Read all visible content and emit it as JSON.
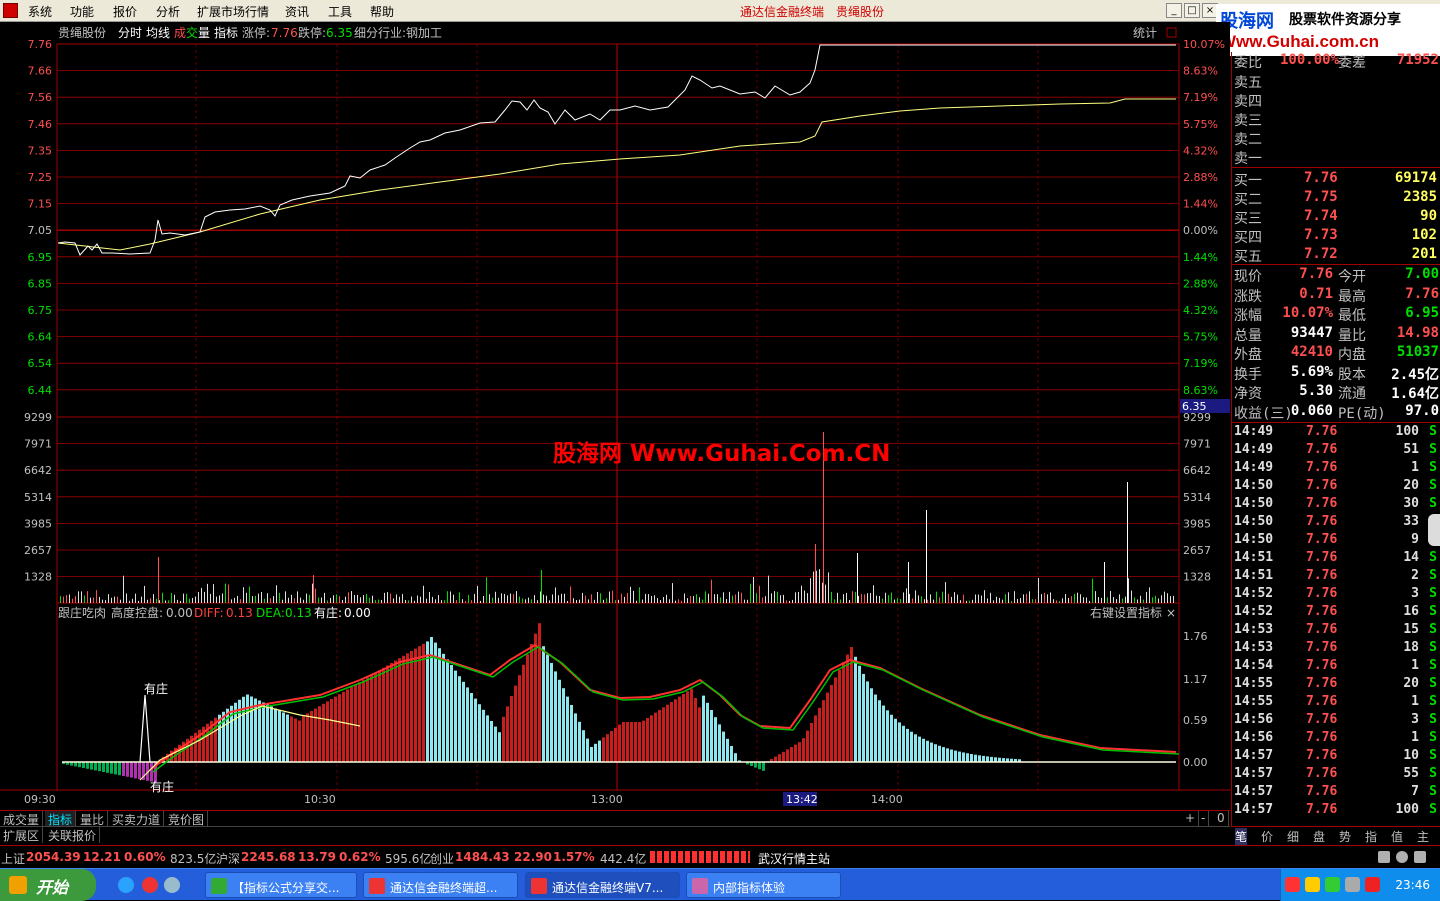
{
  "app": {
    "title": "通达信金融终端",
    "stock_title": "贵绳股份"
  },
  "menu": [
    "系统",
    "功能",
    "报价",
    "分析",
    "扩展市场行情",
    "资讯",
    "工具",
    "帮助"
  ],
  "brand": {
    "cn": "股海网",
    "sub": "股票软件资源分享",
    "url": "Www.Guhai.com.cn"
  },
  "chart_header": {
    "name": "贵绳股份",
    "tabs": [
      "分时",
      "均线"
    ],
    "vol_a": "成",
    "vol_b": "交",
    "vol_c": "量",
    "indicator": "指标",
    "limit_up_label": "涨停:",
    "limit_up": "7.76",
    "limit_down_label": "跌停:",
    "limit_down": "6.35",
    "industry": "细分行业:钢加工",
    "stats": "统计"
  },
  "price_axis": [
    "7.76",
    "7.66",
    "7.56",
    "7.46",
    "7.35",
    "7.25",
    "7.15",
    "7.05",
    "6.95",
    "6.85",
    "6.75",
    "6.64",
    "6.54",
    "6.44"
  ],
  "pct_axis": [
    "10.07%",
    "8.63%",
    "7.19%",
    "5.75%",
    "4.32%",
    "2.88%",
    "1.44%",
    "0.00%",
    "1.44%",
    "2.88%",
    "4.32%",
    "5.75%",
    "7.19%",
    "8.63%"
  ],
  "vol_axis": [
    "9299",
    "7971",
    "6642",
    "5314",
    "3985",
    "2657",
    "1328"
  ],
  "price_floor_tag": "6.35",
  "watermark": "股海网 Www.Guhai.Com.CN",
  "indicator": {
    "name": "跟庄吃肉",
    "k1": "高度控盘:",
    "v1": "0.00",
    "k2": "DIFF:",
    "v2": "0.13",
    "k3": "DEA:",
    "v3": "0.13",
    "k4": "有庄:",
    "v4": "0.00",
    "hint": "右键设置指标",
    "axis": [
      "1.76",
      "1.17",
      "0.59",
      "0.00"
    ],
    "marker1": "有庄",
    "marker2": "有庄"
  },
  "time_axis": [
    "09:30",
    "10:30",
    "13:00",
    "13:42",
    "14:00"
  ],
  "colors": {
    "up": "#ff5050",
    "down": "#00e000",
    "grid": "#a00000",
    "price": "#ffffff",
    "avg": "#ffff80",
    "bar_red": "#c81e1e",
    "bar_cyan": "#8ee6ee"
  },
  "order_book": {
    "ratio_label": "委比",
    "ratio": "100.00%",
    "diff_label": "委差",
    "diff": "71952",
    "sells": [
      "卖五",
      "卖四",
      "卖三",
      "卖二",
      "卖一"
    ],
    "buys": [
      {
        "label": "买一",
        "price": "7.76",
        "vol": "69174"
      },
      {
        "label": "买二",
        "price": "7.75",
        "vol": "2385"
      },
      {
        "label": "买三",
        "price": "7.74",
        "vol": "90"
      },
      {
        "label": "买四",
        "price": "7.73",
        "vol": "102"
      },
      {
        "label": "买五",
        "price": "7.72",
        "vol": "201"
      }
    ]
  },
  "quote": [
    {
      "l1": "现价",
      "v1": "7.76",
      "l2": "今开",
      "v2": "7.00",
      "c1": "up",
      "c2": "down"
    },
    {
      "l1": "涨跌",
      "v1": "0.71",
      "l2": "最高",
      "v2": "7.76",
      "c1": "up",
      "c2": "up"
    },
    {
      "l1": "涨幅",
      "v1": "10.07%",
      "l2": "最低",
      "v2": "6.95",
      "c1": "up",
      "c2": "down"
    },
    {
      "l1": "总量",
      "v1": "93447",
      "l2": "量比",
      "v2": "14.98",
      "c1": "white",
      "c2": "up"
    },
    {
      "l1": "外盘",
      "v1": "42410",
      "l2": "内盘",
      "v2": "51037",
      "c1": "up",
      "c2": "down"
    },
    {
      "l1": "换手",
      "v1": "5.69%",
      "l2": "股本",
      "v2": "2.45亿",
      "c1": "white",
      "c2": "white"
    },
    {
      "l1": "净资",
      "v1": "5.30",
      "l2": "流通",
      "v2": "1.64亿",
      "c1": "white",
      "c2": "white"
    },
    {
      "l1": "收益(三)",
      "v1": "0.060",
      "l2": "PE(动)",
      "v2": "97.0",
      "c1": "white",
      "c2": "white"
    }
  ],
  "ticks": [
    {
      "t": "14:49",
      "p": "7.76",
      "v": "100",
      "s": "S"
    },
    {
      "t": "14:49",
      "p": "7.76",
      "v": "51",
      "s": "S"
    },
    {
      "t": "14:49",
      "p": "7.76",
      "v": "1",
      "s": "S"
    },
    {
      "t": "14:50",
      "p": "7.76",
      "v": "20",
      "s": "S"
    },
    {
      "t": "14:50",
      "p": "7.76",
      "v": "30",
      "s": "S"
    },
    {
      "t": "14:50",
      "p": "7.76",
      "v": "33",
      "s": "S"
    },
    {
      "t": "14:50",
      "p": "7.76",
      "v": "9",
      "s": "S"
    },
    {
      "t": "14:51",
      "p": "7.76",
      "v": "14",
      "s": "S"
    },
    {
      "t": "14:51",
      "p": "7.76",
      "v": "2",
      "s": "S"
    },
    {
      "t": "14:52",
      "p": "7.76",
      "v": "3",
      "s": "S"
    },
    {
      "t": "14:52",
      "p": "7.76",
      "v": "16",
      "s": "S"
    },
    {
      "t": "14:53",
      "p": "7.76",
      "v": "15",
      "s": "S"
    },
    {
      "t": "14:53",
      "p": "7.76",
      "v": "18",
      "s": "S"
    },
    {
      "t": "14:54",
      "p": "7.76",
      "v": "1",
      "s": "S"
    },
    {
      "t": "14:55",
      "p": "7.76",
      "v": "20",
      "s": "S"
    },
    {
      "t": "14:55",
      "p": "7.76",
      "v": "1",
      "s": "S"
    },
    {
      "t": "14:56",
      "p": "7.76",
      "v": "3",
      "s": "S"
    },
    {
      "t": "14:56",
      "p": "7.76",
      "v": "1",
      "s": "S"
    },
    {
      "t": "14:57",
      "p": "7.76",
      "v": "10",
      "s": "S"
    },
    {
      "t": "14:57",
      "p": "7.76",
      "v": "55",
      "s": "S"
    },
    {
      "t": "14:57",
      "p": "7.76",
      "v": "7",
      "s": "S"
    },
    {
      "t": "14:57",
      "p": "7.76",
      "v": "100",
      "s": "S"
    }
  ],
  "bottom_tabs": [
    "成交量",
    "指标",
    "量比",
    "买卖力道",
    "竞价图"
  ],
  "bottom_ctrl": [
    "+",
    "-",
    "0"
  ],
  "ext_tabs": [
    "扩展区",
    "关联报价"
  ],
  "right_tabs": [
    "笔",
    "价",
    "细",
    "盘",
    "势",
    "指",
    "值",
    "主"
  ],
  "status": {
    "sh_label": "上证",
    "sh": "2054.39",
    "sh_chg": "12.21",
    "sh_pct": "0.60%",
    "sh_amt": "823.5亿",
    "sz_label": "沪深",
    "sz": "2245.68",
    "sz_chg": "13.79",
    "sz_pct": "0.62%",
    "sz_amt": "595.6亿",
    "cy_label": "创业",
    "cy": "1484.43",
    "cy_chg": "22.90",
    "cy_pct": "1.57%",
    "cy_amt": "442.4亿",
    "server": "武汉行情主站"
  },
  "taskbar": {
    "start": "开始",
    "tasks": [
      "【指标公式分享交...",
      "通达信金融终端超...",
      "通达信金融终端V7...",
      "内部指标体验"
    ],
    "clock": "23:46"
  }
}
